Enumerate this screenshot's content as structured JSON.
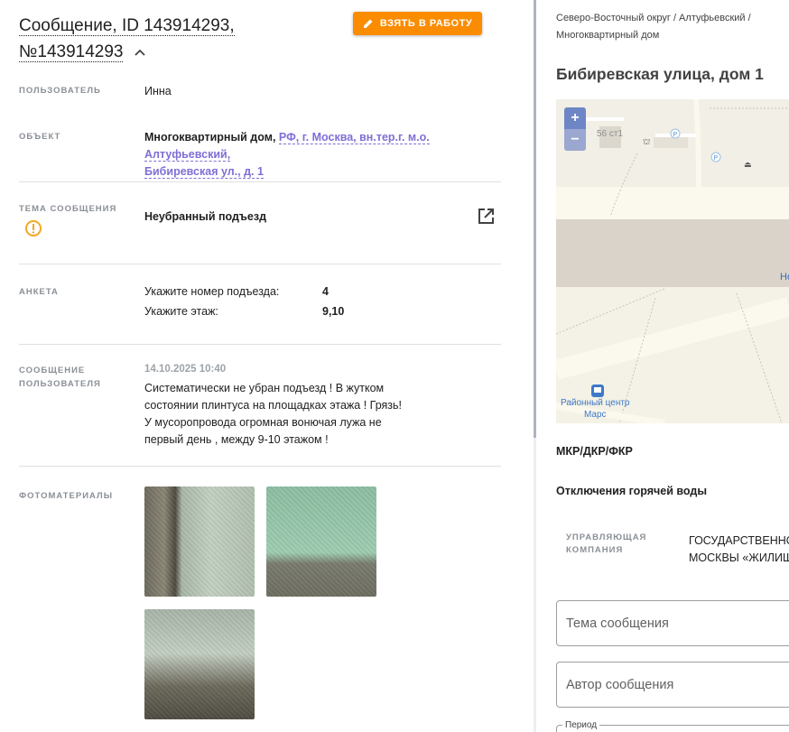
{
  "header": {
    "title_line1": "Сообщение, ID 143914293,",
    "title_line2": "№143914293",
    "take_button": "ВЗЯТЬ В РАБОТУ"
  },
  "details": {
    "user_label": "ПОЛЬЗОВАТЕЛЬ",
    "user_value": "Инна",
    "object_label": "ОБЪЕКТ",
    "object_type": "Многоквартирный дом,",
    "object_link_line1": "РФ, г. Москва, вн.тер.г. м.о. Алтуфьевский,",
    "object_link_line2": "Бибиревская ул., д. 1",
    "topic_label": "ТЕМА СООБЩЕНИЯ",
    "topic_value": "Неубранный подъезд",
    "survey_label": "АНКЕТА",
    "survey": [
      {
        "question": "Укажите номер подъезда:",
        "answer": "4"
      },
      {
        "question": "Укажите этаж:",
        "answer": "9,10"
      }
    ],
    "message_label_line1": "СООБЩЕНИЕ",
    "message_label_line2": "ПОЛЬЗОВАТЕЛЯ",
    "message_date": "14.10.2025 10:40",
    "message_lines": [
      "Систематически не убран подъезд ! В жутком",
      "состоянии плинтуса на площадках этажа ! Грязь!",
      "У мусоропровода огромная вонючая лужа не",
      "первый день , между 9-10 этажом !"
    ],
    "photos_label": "ФОТОМАТЕРИАЛЫ"
  },
  "side": {
    "breadcrumb_line1": "Северо-Восточный округ / Алтуфьевский /",
    "breadcrumb_line2": "Многоквартирный дом",
    "address": "Бибиревская улица, дом 1",
    "map": {
      "zoom_in": "+",
      "zoom_out": "−",
      "building_label": "56 ст1",
      "edge_label": "Но",
      "poi_line1": "Районный центр",
      "poi_line2": "Марс"
    },
    "mkr": "МКР/ДКР/ФКР",
    "hot_water": "Отключения горячей воды",
    "uk_label_line1": "УПРАВЛЯЮЩАЯ",
    "uk_label_line2": "КОМПАНИЯ",
    "uk_value_line1": "ГОСУДАРСТВЕННО",
    "uk_value_line2": "МОСКВЫ «ЖИЛИЩ",
    "topic_field": "Тема сообщения",
    "author_field": "Автор сообщения",
    "period_label": "Период"
  },
  "colors": {
    "accent_orange": "#fb8c00",
    "link_purple": "#7e6fd6",
    "warning": "#f5a623"
  }
}
